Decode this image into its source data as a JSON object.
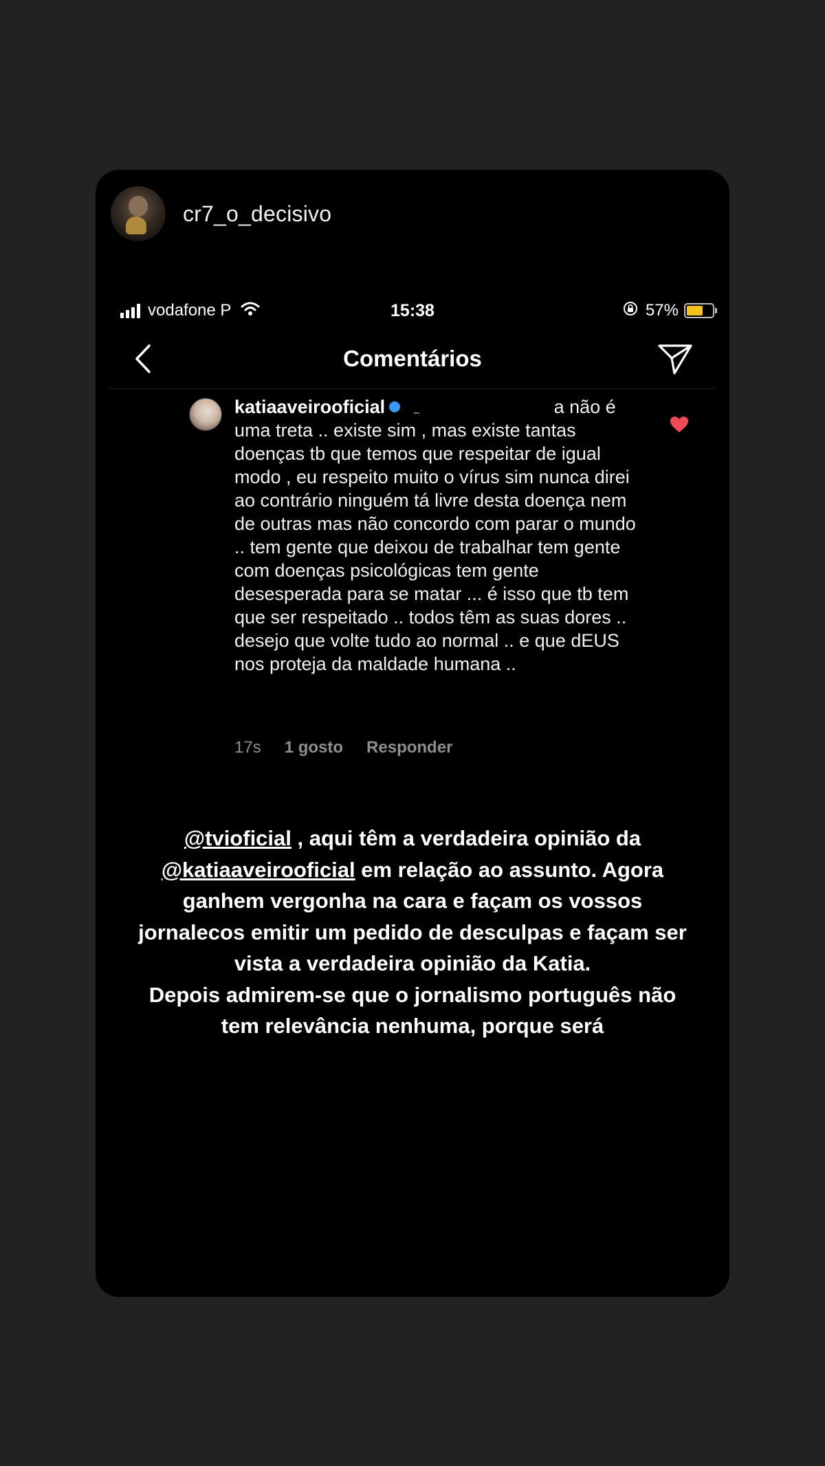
{
  "story": {
    "username": "cr7_o_decisivo"
  },
  "status_bar": {
    "carrier": "vodafone P",
    "time": "15:38",
    "battery_percent": "57%",
    "battery_level": 0.57,
    "battery_color": "#f4c21c"
  },
  "nav": {
    "title": "Comentários"
  },
  "comment": {
    "username": "katiaaveirooficial",
    "first_line_tail": "a não é",
    "text": "uma treta .. existe sim , mas existe tantas doenças tb que temos que respeitar de igual modo , eu respeito muito o vírus sim nunca  direi ao contrário ninguém tá livre desta doença nem de outras mas não concordo com parar o mundo .. tem gente que deixou de trabalhar tem gente com doenças psicológicas tem gente desesperada para se matar ... é isso que tb tem que ser respeitado .. todos têm as suas dores .. desejo que volte tudo ao normal .. e que dEUS nos proteja da maldade humana ..",
    "time_ago": "17s",
    "likes": "1 gosto",
    "reply_label": "Responder",
    "liked_color": "#ed4956"
  },
  "caption": {
    "mention_1": "@tvioficial",
    "part_1": " , aqui têm a verdadeira opinião da ",
    "mention_2": "@katiaaveirooficial",
    "part_2": " em relação ao assunto. Agora ganhem vergonha na cara e façam os vossos jornalecos emitir um pedido de desculpas e façam ser vista a verdadeira opinião da Katia.",
    "part_3": "Depois admirem-se que o jornalismo português não tem relevância nenhuma, porque será"
  }
}
